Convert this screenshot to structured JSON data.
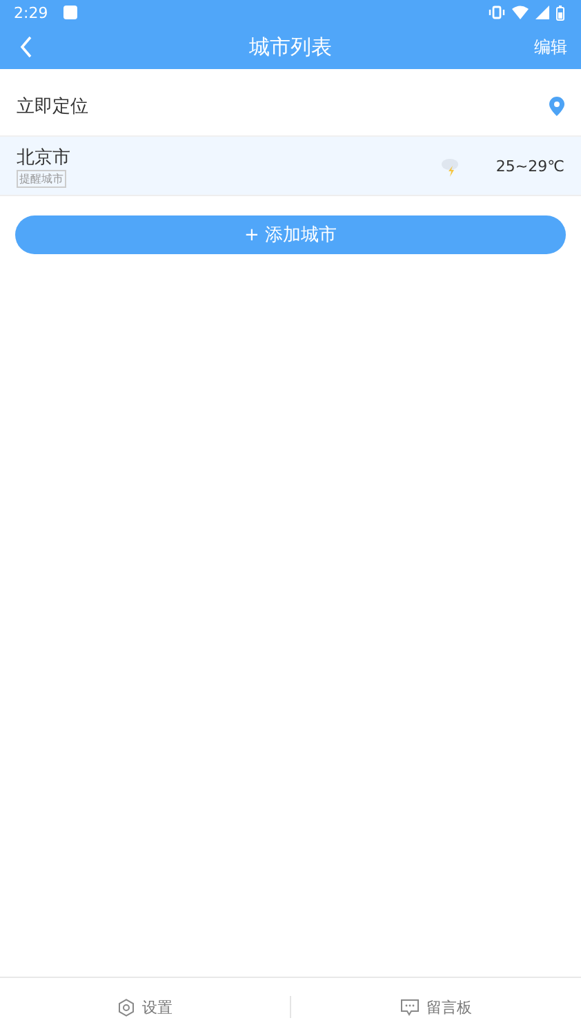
{
  "status_bar": {
    "time": "2:29"
  },
  "header": {
    "title": "城市列表",
    "action": "编辑"
  },
  "locate": {
    "label": "立即定位"
  },
  "cities": [
    {
      "name": "北京市",
      "tag": "提醒城市",
      "temperature": "25~29℃"
    }
  ],
  "add_button": "+ 添加城市",
  "footer": [
    {
      "kind": "settings",
      "label": "设置"
    },
    {
      "kind": "messages",
      "label": "留言板"
    }
  ]
}
